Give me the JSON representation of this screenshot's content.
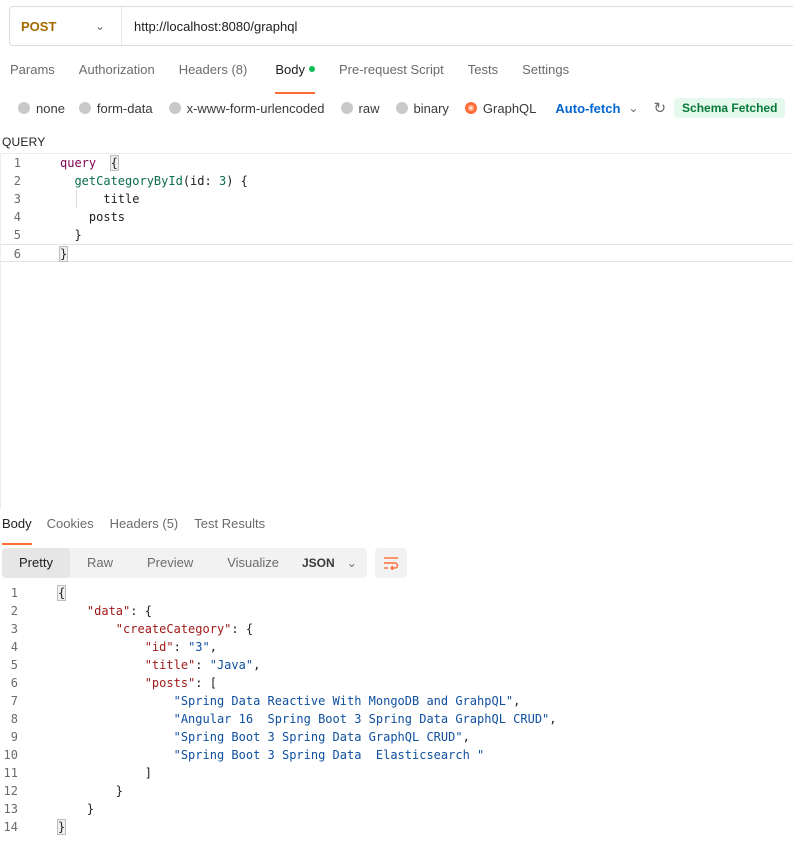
{
  "request": {
    "method": "POST",
    "url": "http://localhost:8080/graphql"
  },
  "request_tabs": [
    {
      "label": "Params"
    },
    {
      "label": "Authorization"
    },
    {
      "label": "Headers",
      "count": "(8)"
    },
    {
      "label": "Body"
    },
    {
      "label": "Pre-request Script"
    },
    {
      "label": "Tests"
    },
    {
      "label": "Settings"
    }
  ],
  "body_types": [
    "none",
    "form-data",
    "x-www-form-urlencoded",
    "raw",
    "binary",
    "GraphQL"
  ],
  "selected_body_type": "GraphQL",
  "auto_fetch_label": "Auto-fetch",
  "schema_badge": "Schema Fetched",
  "query_label": "QUERY",
  "query_lines": [
    "query  {",
    "  getCategoryById(id: 3) {",
    "      title",
    "    posts",
    "  }",
    "}"
  ],
  "response_tabs": [
    {
      "label": "Body"
    },
    {
      "label": "Cookies"
    },
    {
      "label": "Headers",
      "count": "(5)"
    },
    {
      "label": "Test Results"
    }
  ],
  "view_modes": [
    "Pretty",
    "Raw",
    "Preview",
    "Visualize"
  ],
  "format": "JSON",
  "response_lines": [
    "{",
    "    \"data\": {",
    "        \"createCategory\": {",
    "            \"id\": \"3\",",
    "            \"title\": \"Java\",",
    "            \"posts\": [",
    "                \"Spring Data Reactive With MongoDB and GrahpQL\",",
    "                \"Angular 16  Spring Boot 3 Spring Data GraphQL CRUD\",",
    "                \"Spring Boot 3 Spring Data GraphQL CRUD\",",
    "                \"Spring Boot 3 Spring Data  Elasticsearch \"",
    "            ]",
    "        }",
    "    }",
    "}"
  ],
  "colors": {
    "accent": "#ff6c37",
    "post_method": "#a36a00",
    "auto_fetch": "#0265d2",
    "badge_bg": "#e5f8ec",
    "badge_text": "#067a38"
  }
}
